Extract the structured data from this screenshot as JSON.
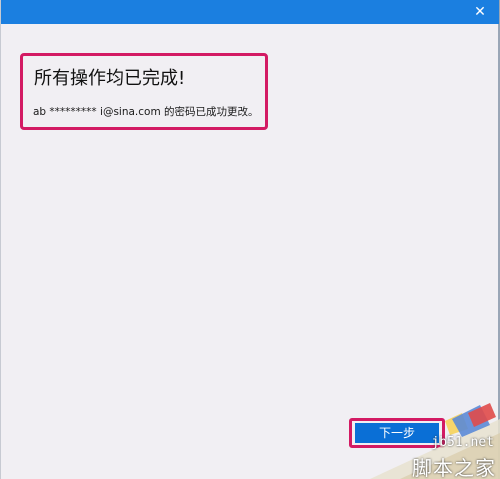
{
  "titlebar": {
    "close_glyph": "✕",
    "accent_color": "#1b7fe0"
  },
  "content": {
    "title": "所有操作均已完成!",
    "message": "ab ********* i@sina.com 的密码已成功更改。"
  },
  "actions": {
    "next_label": "下一步"
  },
  "watermark": {
    "url": "jb51.net",
    "name": "脚本之家"
  },
  "colors": {
    "highlight": "#d31a63",
    "button": "#0a6fd6",
    "background": "#f1eff3"
  }
}
